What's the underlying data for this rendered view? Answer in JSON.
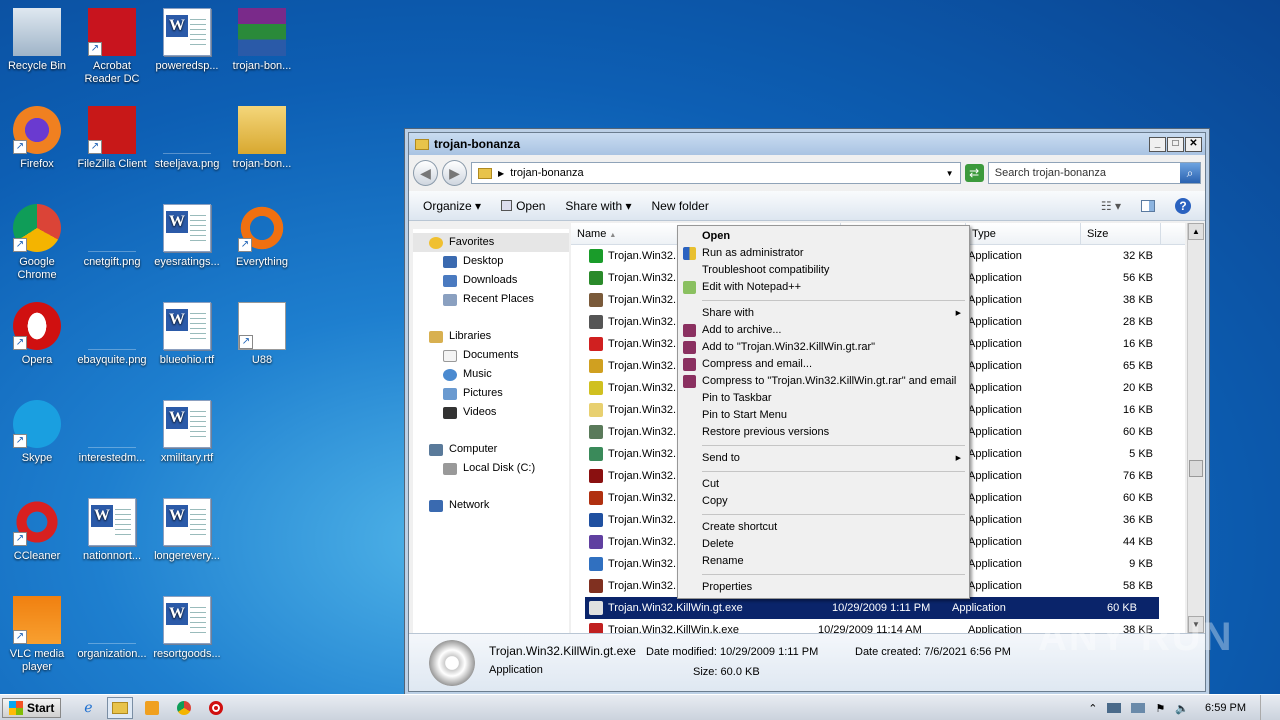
{
  "desktop": {
    "icons": [
      {
        "label": "Recycle Bin",
        "icon": "recycle-bin-icon"
      },
      {
        "label": "Acrobat Reader DC",
        "icon": "acrobat-icon"
      },
      {
        "label": "poweredsp...",
        "icon": "word-doc-icon"
      },
      {
        "label": "trojan-bon...",
        "icon": "rar-archive-icon"
      },
      {
        "label": "Firefox",
        "icon": "firefox-icon"
      },
      {
        "label": "FileZilla Client",
        "icon": "filezilla-icon"
      },
      {
        "label": "steeljava.png",
        "icon": "png-icon"
      },
      {
        "label": "trojan-bon...",
        "icon": "folder-icon"
      },
      {
        "label": "Google Chrome",
        "icon": "chrome-icon"
      },
      {
        "label": "cnetgift.png",
        "icon": "png-icon"
      },
      {
        "label": "eyesratings...",
        "icon": "word-doc-icon"
      },
      {
        "label": "Everything",
        "icon": "everything-icon"
      },
      {
        "label": "Opera",
        "icon": "opera-icon"
      },
      {
        "label": "ebayquite.png",
        "icon": "png-icon"
      },
      {
        "label": "blueohio.rtf",
        "icon": "word-doc-icon"
      },
      {
        "label": "U88",
        "icon": "file-icon"
      },
      {
        "label": "Skype",
        "icon": "skype-icon"
      },
      {
        "label": "interestedm...",
        "icon": "png-icon"
      },
      {
        "label": "xmilitary.rtf",
        "icon": "word-doc-icon"
      },
      {
        "label": "CCleaner",
        "icon": "ccleaner-icon"
      },
      {
        "label": "nationnort...",
        "icon": "word-doc-icon"
      },
      {
        "label": "longerevery...",
        "icon": "word-doc-icon"
      },
      {
        "label": "VLC media player",
        "icon": "vlc-icon"
      },
      {
        "label": "organization...",
        "icon": "png-icon"
      },
      {
        "label": "resortgoods...",
        "icon": "word-doc-icon"
      }
    ]
  },
  "explorer": {
    "title": "trojan-bonanza",
    "address": "trojan-bonanza",
    "search_placeholder": "Search trojan-bonanza",
    "toolbar": {
      "organize": "Organize",
      "open": "Open",
      "share_with": "Share with",
      "new_folder": "New folder"
    },
    "nav": {
      "favorites": "Favorites",
      "desktop": "Desktop",
      "downloads": "Downloads",
      "recent": "Recent Places",
      "libraries": "Libraries",
      "documents": "Documents",
      "music": "Music",
      "pictures": "Pictures",
      "videos": "Videos",
      "computer": "Computer",
      "local_disk": "Local Disk (C:)",
      "network": "Network"
    },
    "columns": {
      "name": "Name",
      "type": "Type",
      "size": "Size"
    },
    "files": [
      {
        "name": "Trojan.Win32.",
        "date": "",
        "type": "Application",
        "size": "32 KB",
        "color": "#1a9c2a"
      },
      {
        "name": "Trojan.Win32.",
        "date": "",
        "type": "Application",
        "size": "56 KB",
        "color": "#2a8a2a"
      },
      {
        "name": "Trojan.Win32.",
        "date": "",
        "type": "Application",
        "size": "38 KB",
        "color": "#7a5a3a"
      },
      {
        "name": "Trojan.Win32.",
        "date": "",
        "type": "Application",
        "size": "28 KB",
        "color": "#555555"
      },
      {
        "name": "Trojan.Win32.",
        "date": "",
        "type": "Application",
        "size": "16 KB",
        "color": "#d02020"
      },
      {
        "name": "Trojan.Win32.",
        "date": "",
        "type": "Application",
        "size": "65 KB",
        "color": "#d0a020"
      },
      {
        "name": "Trojan.Win32.",
        "date": "",
        "type": "Application",
        "size": "20 KB",
        "color": "#d0c020"
      },
      {
        "name": "Trojan.Win32.",
        "date": "",
        "type": "Application",
        "size": "16 KB",
        "color": "#e8d070"
      },
      {
        "name": "Trojan.Win32.",
        "date": "",
        "type": "Application",
        "size": "60 KB",
        "color": "#5a7a5a"
      },
      {
        "name": "Trojan.Win32.",
        "date": "",
        "type": "Application",
        "size": "5 KB",
        "color": "#3a8a5a"
      },
      {
        "name": "Trojan.Win32.",
        "date": "",
        "type": "Application",
        "size": "76 KB",
        "color": "#8a1010"
      },
      {
        "name": "Trojan.Win32.",
        "date": "",
        "type": "Application",
        "size": "60 KB",
        "color": "#b03010"
      },
      {
        "name": "Trojan.Win32.",
        "date": "",
        "type": "Application",
        "size": "36 KB",
        "color": "#2050a0"
      },
      {
        "name": "Trojan.Win32.",
        "date": "",
        "type": "Application",
        "size": "44 KB",
        "color": "#6040a0"
      },
      {
        "name": "Trojan.Win32.",
        "date": "",
        "type": "Application",
        "size": "9 KB",
        "color": "#3070c0"
      },
      {
        "name": "Trojan.Win32.",
        "date": "",
        "type": "Application",
        "size": "58 KB",
        "color": "#803020"
      },
      {
        "name": "Trojan.Win32.KillWin.gt.exe",
        "date": "10/29/2009 1:11 PM",
        "type": "Application",
        "size": "60 KB",
        "color": "#e0e0e0",
        "selected": true
      },
      {
        "name": "Trojan.Win32.KillWin.k.exe",
        "date": "10/29/2009 11:14 AM",
        "type": "Application",
        "size": "38 KB",
        "color": "#c02020"
      }
    ],
    "details": {
      "filename": "Trojan.Win32.KillWin.gt.exe",
      "filetype": "Application",
      "modified_label": "Date modified:",
      "modified": "10/29/2009 1:11 PM",
      "created_label": "Date created:",
      "created": "7/6/2021 6:56 PM",
      "size_label": "Size:",
      "size": "60.0 KB"
    }
  },
  "context_menu": {
    "open": "Open",
    "run_admin": "Run as administrator",
    "troubleshoot": "Troubleshoot compatibility",
    "notepad": "Edit with Notepad++",
    "share_with": "Share with",
    "add_archive": "Add to archive...",
    "add_rar": "Add to \"Trojan.Win32.KillWin.gt.rar\"",
    "compress_email": "Compress and email...",
    "compress_rar_email": "Compress to \"Trojan.Win32.KillWin.gt.rar\" and email",
    "pin_taskbar": "Pin to Taskbar",
    "pin_start": "Pin to Start Menu",
    "restore": "Restore previous versions",
    "send_to": "Send to",
    "cut": "Cut",
    "copy": "Copy",
    "create_shortcut": "Create shortcut",
    "delete": "Delete",
    "rename": "Rename",
    "properties": "Properties"
  },
  "taskbar": {
    "start": "Start",
    "clock": "6:59 PM"
  },
  "watermark": "ANY RUN"
}
